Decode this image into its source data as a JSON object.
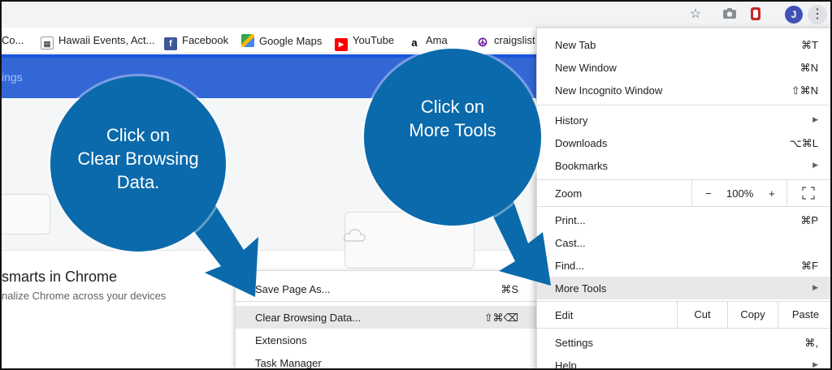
{
  "toolbar": {
    "avatar_letter": "J"
  },
  "bookmarks": [
    {
      "label": "Co...",
      "icon": "page-icon"
    },
    {
      "label": "Hawaii Events, Act...",
      "icon": "document-icon"
    },
    {
      "label": "Facebook",
      "icon": "facebook-icon",
      "color": "#3b5998"
    },
    {
      "label": "Google Maps",
      "icon": "maps-icon"
    },
    {
      "label": "YouTube",
      "icon": "youtube-icon",
      "color": "#ff0000"
    },
    {
      "label": "Ama",
      "icon": "amazon-icon"
    },
    {
      "label": "craigslist",
      "icon": "peace-icon",
      "color": "#6a1b9a"
    }
  ],
  "settings": {
    "title": "ings"
  },
  "page": {
    "heading": "smarts in Chrome",
    "subtext": "nalize Chrome across your devices"
  },
  "menu": {
    "new_tab": {
      "label": "New Tab",
      "shortcut": "⌘T"
    },
    "new_window": {
      "label": "New Window",
      "shortcut": "⌘N"
    },
    "new_incognito": {
      "label": "New Incognito Window",
      "shortcut": "⇧⌘N"
    },
    "history": {
      "label": "History"
    },
    "downloads": {
      "label": "Downloads",
      "shortcut": "⌥⌘L"
    },
    "bookmarks": {
      "label": "Bookmarks"
    },
    "zoom": {
      "label": "Zoom",
      "minus": "−",
      "value": "100%",
      "plus": "+"
    },
    "print": {
      "label": "Print...",
      "shortcut": "⌘P"
    },
    "cast": {
      "label": "Cast..."
    },
    "find": {
      "label": "Find...",
      "shortcut": "⌘F"
    },
    "more_tools": {
      "label": "More Tools"
    },
    "edit": {
      "label": "Edit",
      "cut": "Cut",
      "copy": "Copy",
      "paste": "Paste"
    },
    "settings": {
      "label": "Settings",
      "shortcut": "⌘,"
    },
    "help": {
      "label": "Help"
    }
  },
  "submenu": {
    "save_page": {
      "label": "Save Page As...",
      "shortcut": "⌘S"
    },
    "clear_data": {
      "label": "Clear Browsing Data...",
      "shortcut": "⇧⌘⌫"
    },
    "extensions": {
      "label": "Extensions"
    },
    "task_manager": {
      "label": "Task Manager"
    }
  },
  "callouts": {
    "left": [
      "Click on",
      "Clear Browsing",
      "Data."
    ],
    "right": [
      "Click on",
      "More Tools"
    ]
  },
  "colors": {
    "callout": "#0a6aab",
    "header": "#3367d6"
  }
}
